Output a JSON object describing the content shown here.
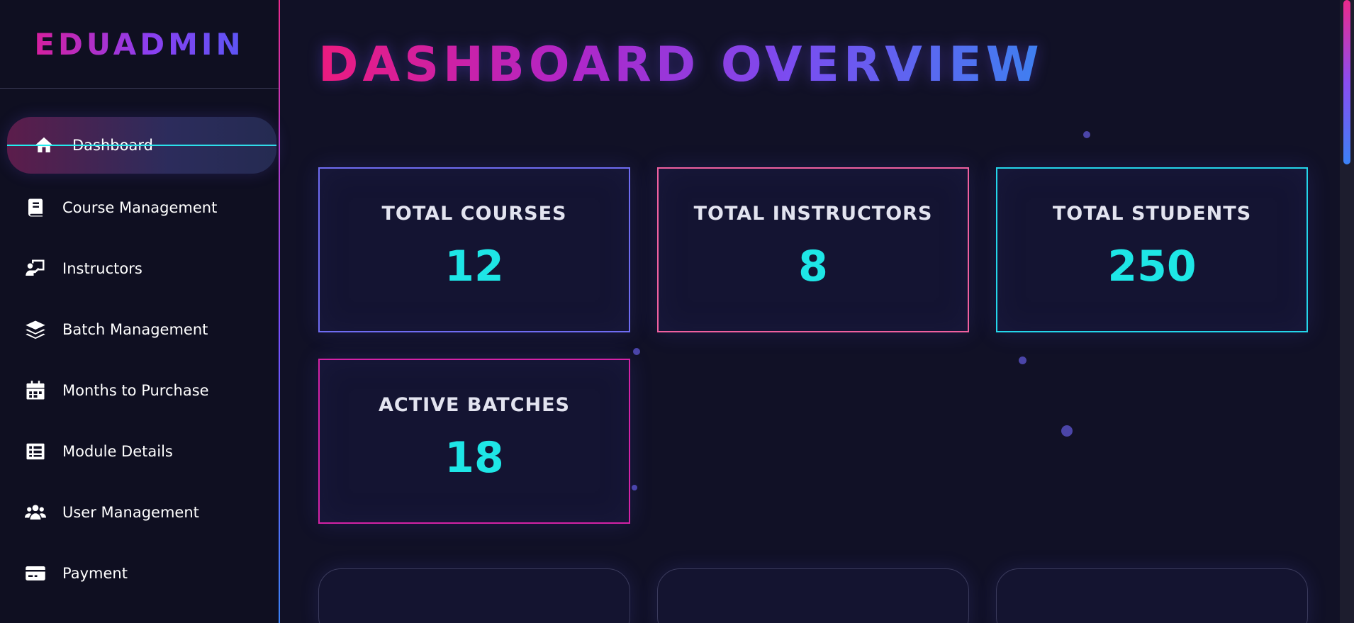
{
  "brand": {
    "name": "EDUADMIN"
  },
  "sidebar": {
    "items": [
      {
        "label": "Dashboard",
        "icon": "home-icon",
        "active": true
      },
      {
        "label": "Course Management",
        "icon": "book-icon"
      },
      {
        "label": "Instructors",
        "icon": "chalkboard-teacher-icon"
      },
      {
        "label": "Batch Management",
        "icon": "layers-icon"
      },
      {
        "label": "Months to Purchase",
        "icon": "calendar-icon"
      },
      {
        "label": "Module Details",
        "icon": "list-icon"
      },
      {
        "label": "User Management",
        "icon": "users-icon"
      },
      {
        "label": "Payment",
        "icon": "credit-card-icon"
      }
    ]
  },
  "main": {
    "title": "DASHBOARD OVERVIEW",
    "stats": [
      {
        "label": "TOTAL COURSES",
        "value": "12"
      },
      {
        "label": "TOTAL INSTRUCTORS",
        "value": "8"
      },
      {
        "label": "TOTAL STUDENTS",
        "value": "250"
      },
      {
        "label": "ACTIVE BATCHES",
        "value": "18"
      }
    ]
  },
  "colors": {
    "accent_cyan": "#1ee6e6",
    "accent_pink": "#ec1b7f",
    "accent_purple": "#7b4cf0",
    "accent_blue": "#3e80f0",
    "background": "#111126"
  }
}
